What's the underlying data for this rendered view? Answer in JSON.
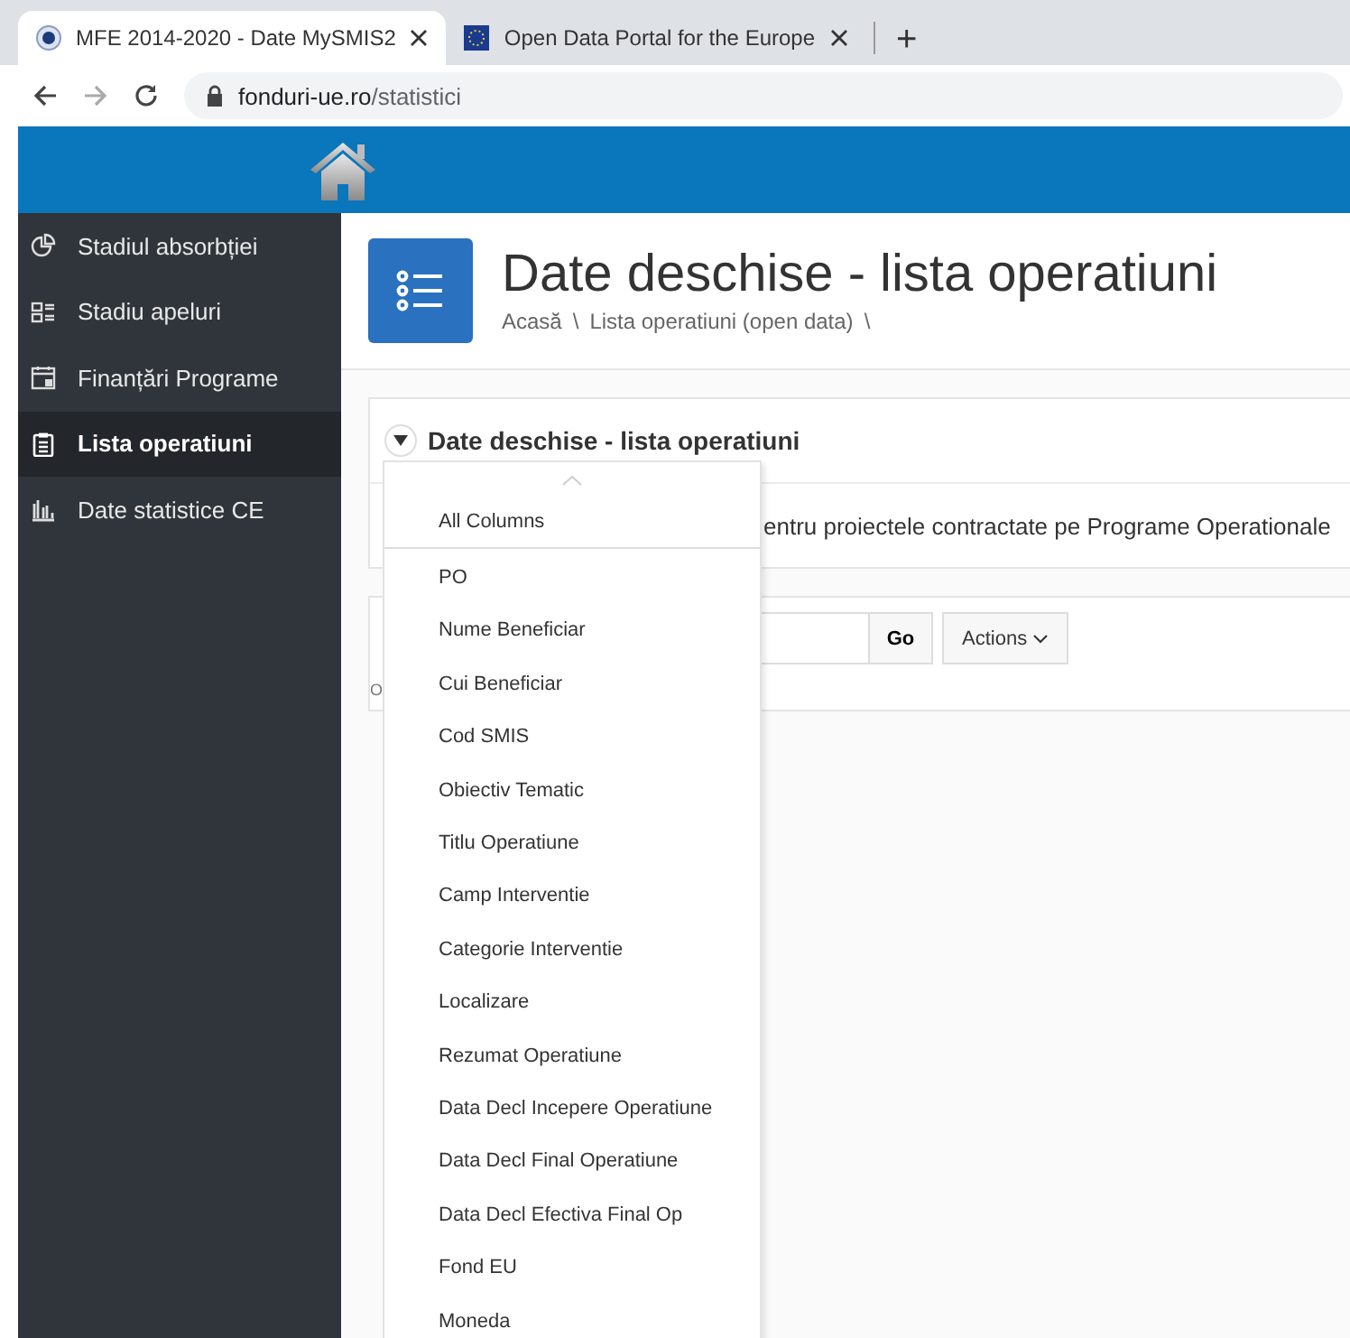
{
  "browser": {
    "tabs": [
      {
        "title": "MFE 2014-2020 - Date MySMIS2",
        "selected": true
      },
      {
        "title": "Open Data Portal for the Europe",
        "selected": false
      }
    ],
    "new_tab": "+",
    "url": {
      "host": "fonduri-ue.ro",
      "path": "/statistici"
    }
  },
  "sidebar": {
    "items": [
      {
        "label": "Stadiul absorbției",
        "selected": false
      },
      {
        "label": "Stadiu apeluri",
        "selected": false
      },
      {
        "label": "Finanțări Programe",
        "selected": false
      },
      {
        "label": "Lista operatiuni",
        "selected": true
      },
      {
        "label": "Date statistice CE",
        "selected": false
      }
    ]
  },
  "page": {
    "title": "Date deschise - lista operatiuni",
    "breadcrumb": [
      "Acasă",
      "Lista operatiuni (open data)"
    ],
    "separator": "\\"
  },
  "region": {
    "title": "Date deschise - lista operatiuni",
    "expanded": true,
    "description": "entru proiectele contractate pe Programe Operationale"
  },
  "report": {
    "go": "Go",
    "actions": "Actions",
    "error": "O"
  },
  "column_menu": {
    "items": [
      {
        "label": "All Columns"
      },
      {
        "label": "PO"
      },
      {
        "label": "Nume Beneficiar"
      },
      {
        "label": "Cui Beneficiar"
      },
      {
        "label": "Cod SMIS"
      },
      {
        "label": "Obiectiv Tematic"
      },
      {
        "label": "Titlu Operatiune"
      },
      {
        "label": "Camp Interventie"
      },
      {
        "label": "Categorie Interventie"
      },
      {
        "label": "Localizare"
      },
      {
        "label": "Rezumat Operatiune"
      },
      {
        "label": "Data Decl Incepere Operatiune"
      },
      {
        "label": "Data Decl Final Operatiune"
      },
      {
        "label": "Data Decl Efectiva Final Op"
      },
      {
        "label": "Fond EU"
      },
      {
        "label": "Moneda"
      }
    ]
  }
}
